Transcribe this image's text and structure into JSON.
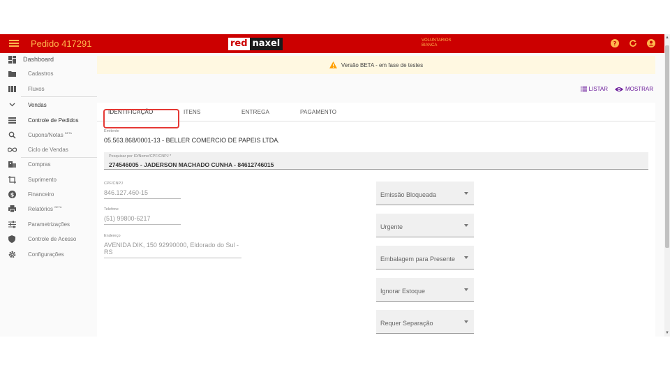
{
  "topbar": {
    "title": "Pedido 417291",
    "logo_left": "red",
    "logo_right": "naxel",
    "user_line1": "VOLUNTARIOS",
    "user_line2": "BIANCA",
    "icons": [
      "help-icon",
      "refresh-icon",
      "account-icon"
    ]
  },
  "sidebar": {
    "dashboard": "Dashboard",
    "items": [
      {
        "label": "Cadastros",
        "icon": "folder-icon"
      },
      {
        "label": "Fluxos",
        "icon": "columns-icon"
      },
      {
        "label": "Vendas",
        "icon": "chevron-down-icon"
      },
      {
        "label": "Controle de Pedidos",
        "icon": "list-icon"
      },
      {
        "label": "Cupons/Notas",
        "badge": "BETA",
        "icon": "search-doc-icon"
      },
      {
        "label": "Ciclo de Vendas",
        "icon": "infinity-icon"
      },
      {
        "label": "Compras",
        "icon": "building-icon"
      },
      {
        "label": "Suprimento",
        "icon": "crop-icon"
      },
      {
        "label": "Financeiro",
        "icon": "dollar-icon"
      },
      {
        "label": "Relatórios",
        "badge": "BETA",
        "icon": "print-icon"
      },
      {
        "label": "Parametrizações",
        "icon": "sliders-icon"
      },
      {
        "label": "Controle de Acesso",
        "icon": "shield-icon"
      },
      {
        "label": "Configurações",
        "icon": "gear-icon"
      }
    ]
  },
  "banner": {
    "text": "Versão BETA - em fase de testes"
  },
  "actions": {
    "list": "LISTAR",
    "show": "MOSTRAR"
  },
  "tabs": [
    "IDENTIFICAÇÃO",
    "ITENS",
    "ENTREGA",
    "PAGAMENTO"
  ],
  "form": {
    "emitente_label": "Emitente",
    "emitente_value": "05.563.868/0001-13 - BELLER COMERCIO DE PAPEIS LTDA.",
    "search_label": "Pesquisar por ID/Nome/CPF/CNPJ *",
    "search_value": "274546005 - JADERSON MACHADO CUNHA - 84612746015",
    "cpf_label": "CPF/CNPJ",
    "cpf_value": "846.127.460-15",
    "phone_label": "Telefone",
    "phone_value": "(51) 99800-6217",
    "address_label": "Endereço",
    "address_line1": "AVENIDA DIK, 150 92990000, Eldorado do Sul -",
    "address_line2": "RS"
  },
  "dropdowns": [
    "Emissão Bloqueada",
    "Urgente",
    "Embalagem para Presente",
    "Ignorar Estoque",
    "Requer Separação"
  ],
  "colors": {
    "brand": "#cc0000",
    "accent": "#ffb74d",
    "highlight": "#e53935",
    "link": "#6a1b9a"
  }
}
